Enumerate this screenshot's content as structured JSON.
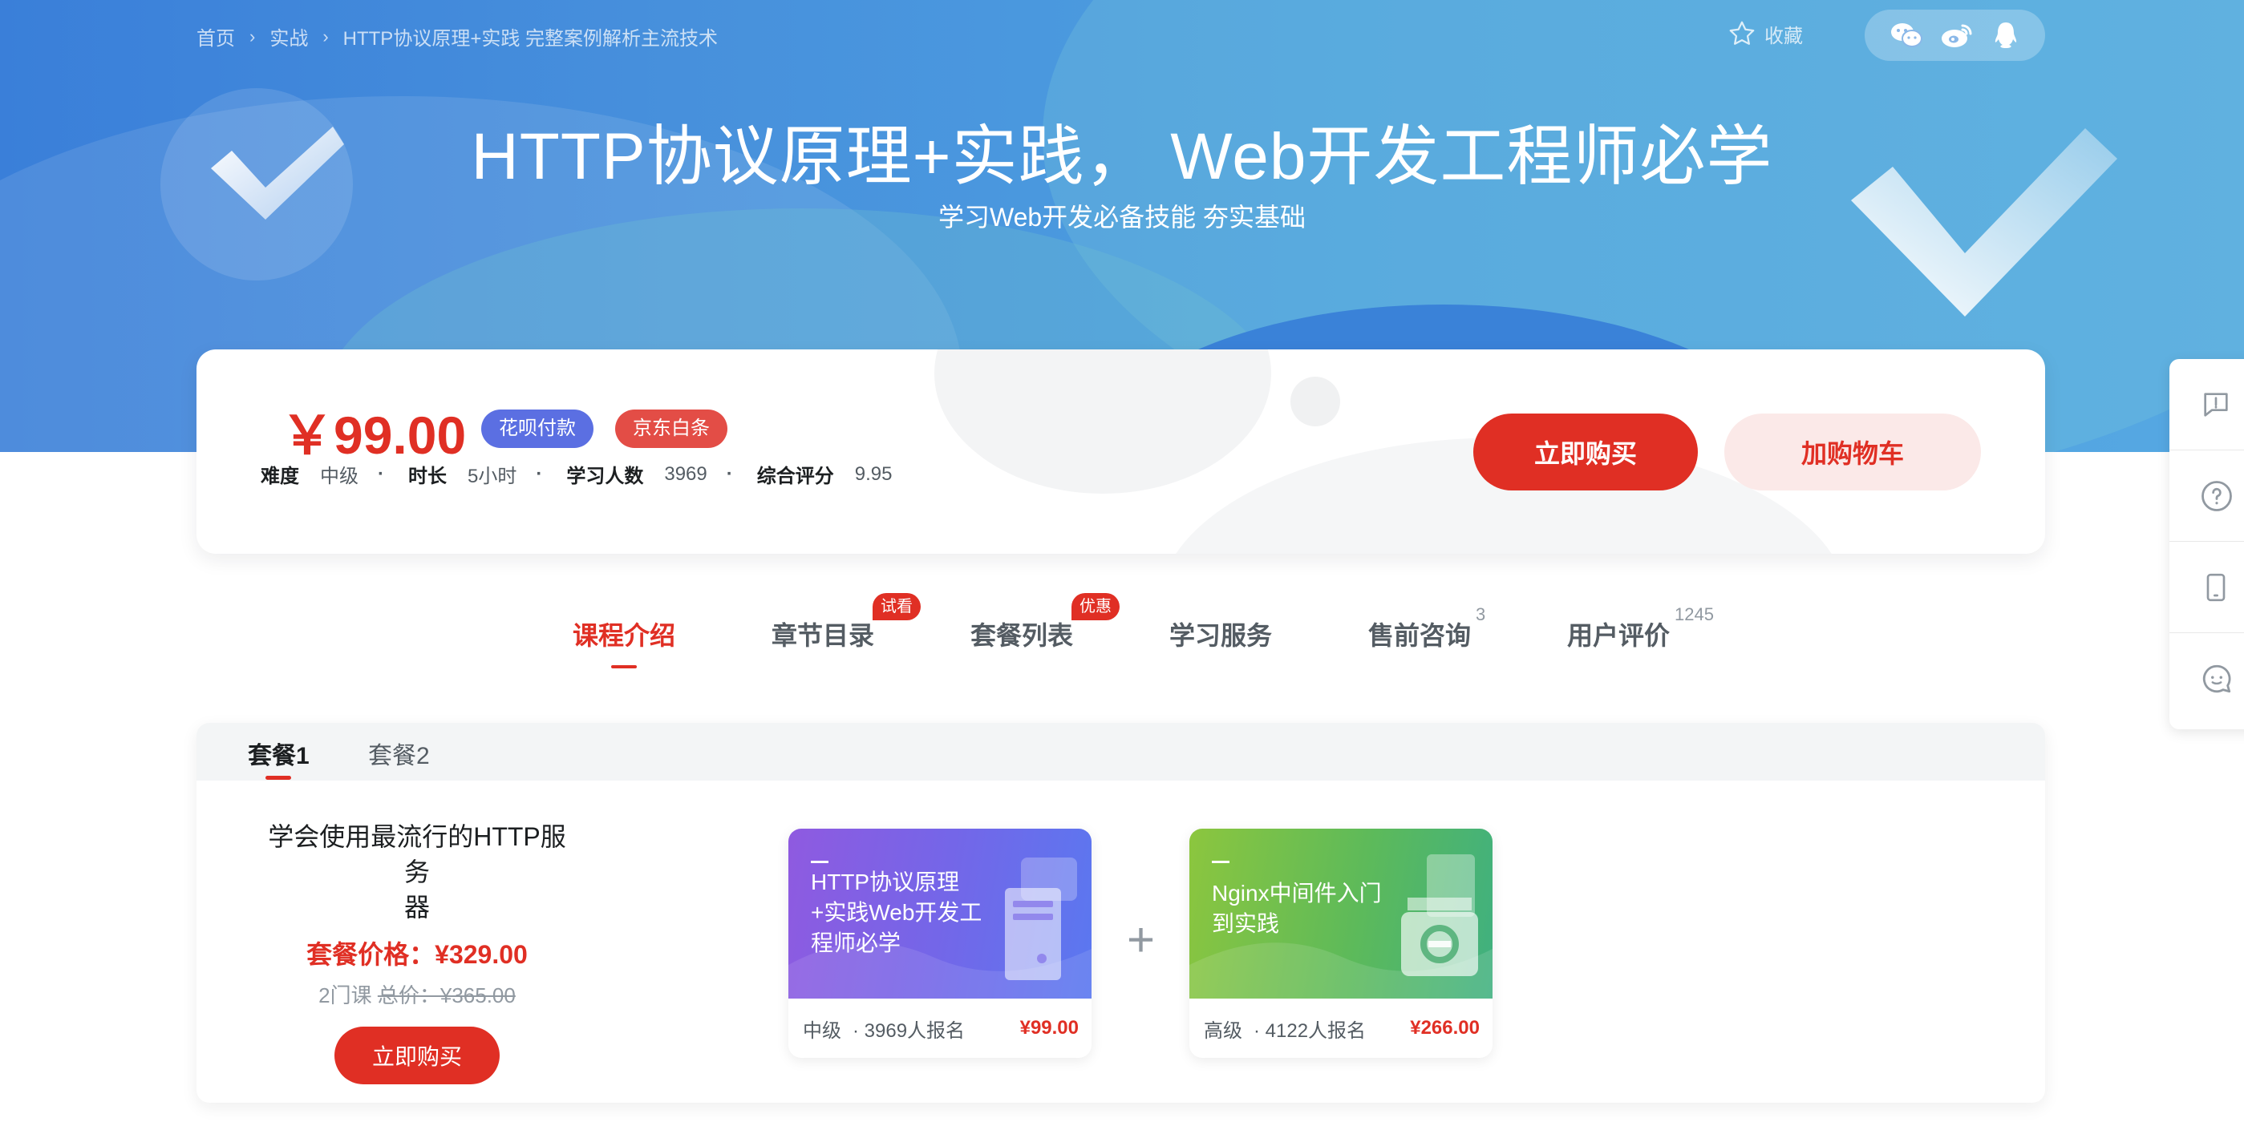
{
  "breadcrumb": [
    "首页",
    "实战",
    "HTTP协议原理+实践 完整案例解析主流技术"
  ],
  "favorite_label": "收藏",
  "share_icons": [
    "wechat-icon",
    "weibo-icon",
    "qq-icon"
  ],
  "hero": {
    "title": "HTTP协议原理+实践， Web开发工程师必学",
    "subtitle": "学习Web开发必备技能 夯实基础"
  },
  "course_info": {
    "price": "￥99.00",
    "badges": [
      "花呗付款",
      "京东白条"
    ],
    "meta": [
      {
        "label": "难度",
        "value": "中级"
      },
      {
        "label": "时长",
        "value": "5小时"
      },
      {
        "label": "学习人数",
        "value": "3969"
      },
      {
        "label": "综合评分",
        "value": "9.95"
      }
    ],
    "buy_label": "立即购买",
    "cart_label": "加购物车"
  },
  "side_tools": [
    "feedback-icon",
    "help-icon",
    "mobile-icon",
    "chat-icon"
  ],
  "tabs": [
    {
      "label": "课程介绍",
      "tag": "",
      "sup": ""
    },
    {
      "label": "章节目录",
      "tag": "试看",
      "sup": ""
    },
    {
      "label": "套餐列表",
      "tag": "优惠",
      "sup": ""
    },
    {
      "label": "学习服务",
      "tag": "",
      "sup": ""
    },
    {
      "label": "售前咨询",
      "tag": "",
      "sup": "3"
    },
    {
      "label": "用户评价",
      "tag": "",
      "sup": "1245"
    }
  ],
  "package": {
    "tabs": [
      "套餐1",
      "套餐2"
    ],
    "title_line1": "学会使用最流行的HTTP服务",
    "title_line2": "器",
    "price_label": "套餐价格：¥329.00",
    "course_count": "2门课",
    "total_label": "总价：¥365.00",
    "buy_label": "立即购买",
    "plus": "+",
    "courses": [
      {
        "title": "HTTP协议原理+实践Web开发工程师必学",
        "level": "中级",
        "enrolled": "· 3969人报名",
        "price": "¥99.00"
      },
      {
        "title": "Nginx中间件入门到实践",
        "level": "高级",
        "enrolled": "· 4122人报名",
        "price": "¥266.00"
      }
    ]
  },
  "colors": {
    "accent": "#e02f24",
    "banner": "#4790dc",
    "huabei": "#5b6fe2",
    "jd": "#e34d46"
  }
}
